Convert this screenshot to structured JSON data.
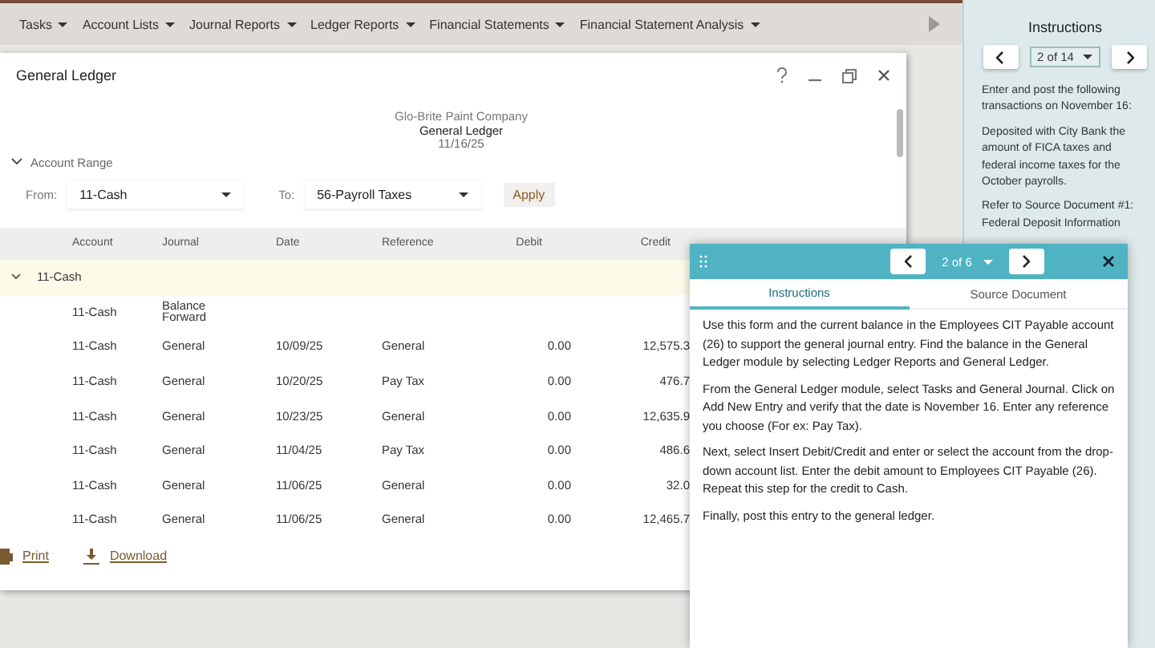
{
  "menu": [
    {
      "label": "Tasks"
    },
    {
      "label": "Account Lists"
    },
    {
      "label": "Journal Reports"
    },
    {
      "label": "Ledger Reports"
    },
    {
      "label": "Financial Statements"
    },
    {
      "label": "Financial Statement Analysis"
    }
  ],
  "window": {
    "title": "General Ledger",
    "company": "Glo-Brite Paint Company",
    "report": "General Ledger",
    "date": "11/16/25"
  },
  "account_range": {
    "label": "Account Range",
    "expanded": true,
    "from_label": "From:",
    "from_value": "11-Cash",
    "to_label": "To:",
    "to_value": "56-Payroll Taxes",
    "apply": "Apply"
  },
  "table": {
    "columns": [
      "Account",
      "Journal",
      "Date",
      "Reference",
      "Debit",
      "Credit"
    ],
    "group": {
      "label": "11-Cash",
      "expanded": true
    },
    "rows": [
      {
        "cells": [
          "11-Cash",
          "Balance Forward",
          "",
          "",
          "",
          ""
        ]
      },
      {
        "cells": [
          "11-Cash",
          "General",
          "10/09/25",
          "General",
          "0.00",
          "12,575.3"
        ]
      },
      {
        "cells": [
          "11-Cash",
          "General",
          "10/20/25",
          "Pay Tax",
          "0.00",
          "476.7"
        ]
      },
      {
        "cells": [
          "11-Cash",
          "General",
          "10/23/25",
          "General",
          "0.00",
          "12,635.9"
        ]
      },
      {
        "cells": [
          "11-Cash",
          "General",
          "11/04/25",
          "Pay Tax",
          "0.00",
          "486.6"
        ]
      },
      {
        "cells": [
          "11-Cash",
          "General",
          "11/06/25",
          "General",
          "0.00",
          "32.0"
        ]
      },
      {
        "cells": [
          "11-Cash",
          "General",
          "11/06/25",
          "General",
          "0.00",
          "12,465.7"
        ]
      }
    ]
  },
  "footer": {
    "print": "Print",
    "download": "Download"
  },
  "side_panel": {
    "title": "Instructions",
    "page": "2 of 14",
    "paragraphs": [
      "Enter and post the following transactions on November 16:",
      "Deposited with City Bank the amount of FICA taxes and federal income taxes for the October payrolls.",
      "Refer to Source Document #1: Federal Deposit Information"
    ]
  },
  "dialog": {
    "page": "2 of 6",
    "tabs": [
      {
        "label": "Instructions",
        "selected": true
      },
      {
        "label": "Source Document",
        "selected": false
      }
    ],
    "paragraphs": [
      "Use this form and the current balance in the Employees CIT Payable account (26) to support the general journal entry. Find the balance in the General Ledger module by selecting Ledger Reports and General Ledger.",
      "From the General Ledger module, select Tasks and General Journal. Click on Add New Entry and verify that the date is November 16. Enter any reference you choose (For ex: Pay Tax).",
      "Next, select Insert Debit/Credit and enter or select the account from the drop-down account list. Enter the debit amount to Employees CIT Payable (26). Repeat this step for the credit to Cash.",
      "Finally, post this entry to the general ledger."
    ]
  }
}
